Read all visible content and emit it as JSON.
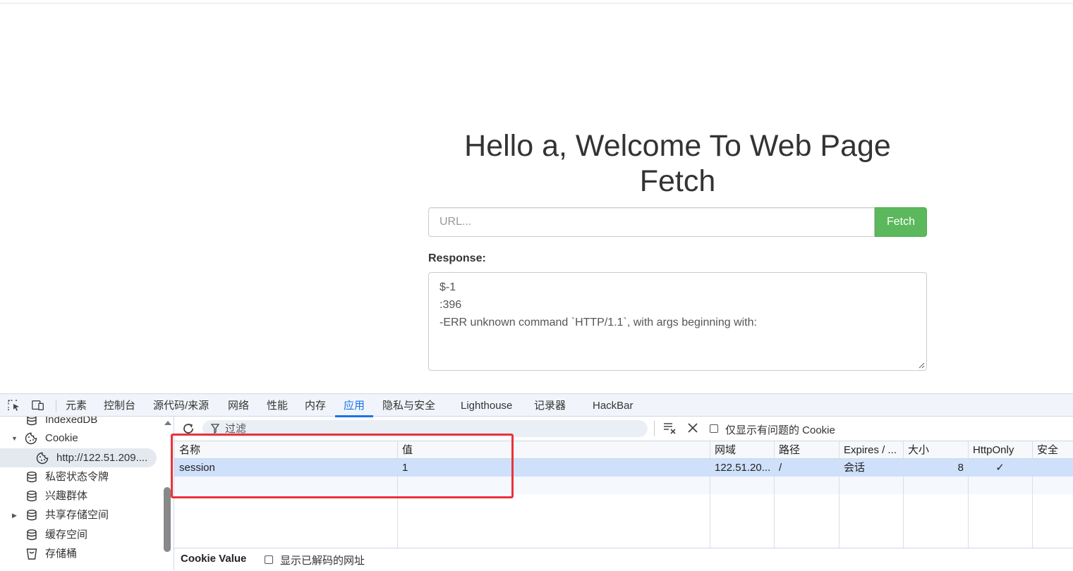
{
  "page": {
    "heading": "Hello a, Welcome To Web Page Fetch",
    "url_placeholder": "URL...",
    "fetch_label": "Fetch",
    "response_label": "Response:",
    "response_text": "$-1\n:396\n-ERR unknown command `HTTP/1.1`, with args beginning with:"
  },
  "devtools": {
    "tabs": [
      {
        "label": "元素"
      },
      {
        "label": "控制台"
      },
      {
        "label": "源代码/来源"
      },
      {
        "label": "网络"
      },
      {
        "label": "性能"
      },
      {
        "label": "内存"
      },
      {
        "label": "应用",
        "active": true
      },
      {
        "label": "隐私与安全"
      },
      {
        "label": "Lighthouse"
      },
      {
        "label": "记录器"
      },
      {
        "label": "HackBar"
      }
    ],
    "sidebar": [
      {
        "label": "IndexedDB",
        "icon": "database-icon"
      },
      {
        "label": "Cookie",
        "icon": "cookie-icon"
      },
      {
        "label": "http://122.51.209....",
        "icon": "cookie-icon"
      },
      {
        "label": "私密状态令牌",
        "icon": "database-icon"
      },
      {
        "label": "兴趣群体",
        "icon": "database-icon"
      },
      {
        "label": "共享存储空间",
        "icon": "database-icon"
      },
      {
        "label": "缓存空间",
        "icon": "database-icon"
      },
      {
        "label": "存储桶",
        "icon": "bucket-icon"
      }
    ],
    "toolbar": {
      "filter_placeholder": "过滤",
      "only_issues_label": "仅显示有问题的 Cookie"
    },
    "columns": [
      "名称",
      "值",
      "网域",
      "路径",
      "Expires / ...",
      "大小",
      "HttpOnly",
      "安全"
    ],
    "rows": [
      {
        "name": "session",
        "value": "1",
        "domain": "122.51.20...",
        "path": "/",
        "expires": "会话",
        "size": "8",
        "httponly": "✓",
        "secure": ""
      }
    ],
    "bottom": {
      "cookie_value_label": "Cookie Value",
      "decoded_label": "显示已解码的网址"
    },
    "colors": {
      "accent": "#1a73e8",
      "fetch_button": "#5cb85c",
      "highlight_box": "#e8333c",
      "selected_row": "#cfe0fb"
    }
  }
}
